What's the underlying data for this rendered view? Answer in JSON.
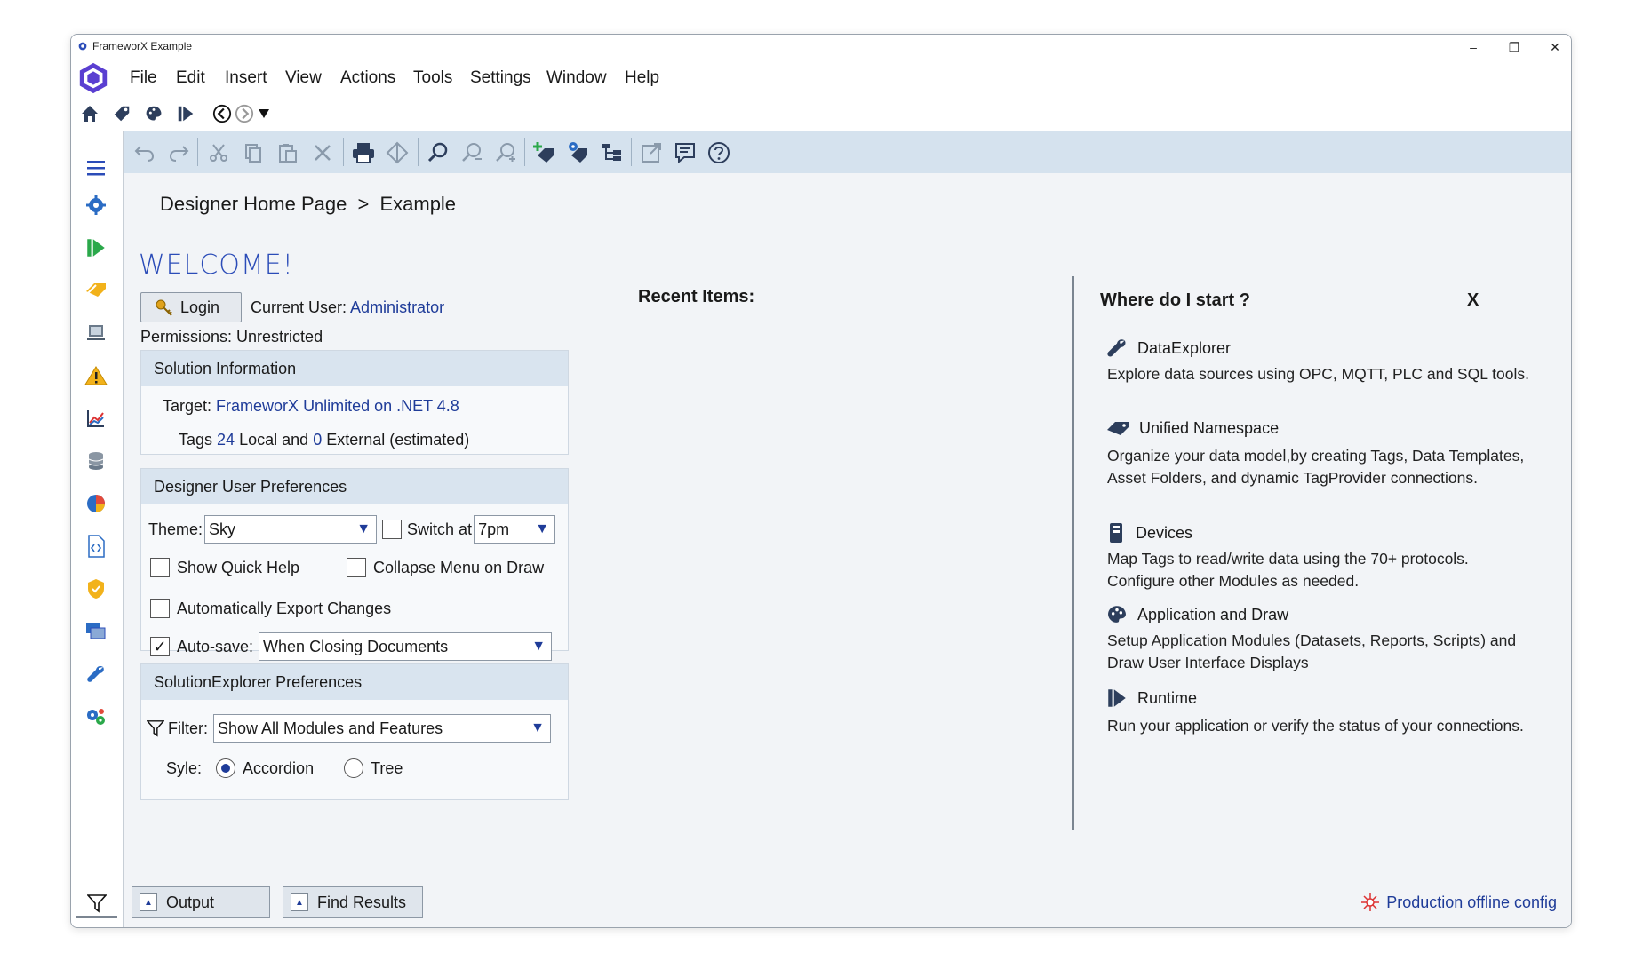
{
  "window": {
    "title": "FrameworX Example"
  },
  "window_controls": {
    "minimize": "–",
    "maximize": "❐",
    "close": "✕"
  },
  "menu": [
    "File",
    "Edit",
    "Insert",
    "View",
    "Actions",
    "Tools",
    "Settings",
    "Window",
    "Help"
  ],
  "breadcrumb": {
    "home": "Designer Home Page",
    "sep": ">",
    "current": "Example"
  },
  "welcome": "WELCOME!",
  "login": {
    "button": "Login",
    "current_user_label": "Current User:",
    "current_user": "Administrator",
    "permissions_label": "Permissions:",
    "permissions": "Unrestricted"
  },
  "solution_info": {
    "header": "Solution Information",
    "target_label": "Target:",
    "target": "FrameworX Unlimited on .NET 4.8",
    "tags_label": "Tags",
    "tags_local": "24",
    "local_text": "Local and",
    "tags_external": "0",
    "external_text": "External (estimated)"
  },
  "designer_prefs": {
    "header": "Designer User Preferences",
    "theme_label": "Theme:",
    "theme_value": "Sky",
    "switch_label": "Switch at",
    "switch_value": "7pm",
    "switch_checked": false,
    "show_quick_help": "Show Quick Help",
    "show_quick_help_checked": false,
    "collapse_menu": "Collapse Menu on Draw",
    "collapse_menu_checked": false,
    "auto_export": "Automatically Export Changes",
    "auto_export_checked": false,
    "auto_save_label": "Auto-save:",
    "auto_save_checked": true,
    "auto_save_value": "When Closing Documents"
  },
  "solution_explorer_prefs": {
    "header": "SolutionExplorer Preferences",
    "filter_label": "Filter:",
    "filter_value": "Show All Modules and Features",
    "style_label": "Syle:",
    "style_options": [
      "Accordion",
      "Tree"
    ],
    "style_selected": "Accordion"
  },
  "recent": {
    "title": "Recent Items:"
  },
  "where_start": {
    "title": "Where do I start ?",
    "close": "X",
    "items": [
      {
        "title": "DataExplorer",
        "icon": "wrench-icon",
        "desc": "Explore data sources using OPC, MQTT, PLC and SQL tools."
      },
      {
        "title": "Unified Namespace",
        "icon": "tag-icon",
        "desc": "Organize your data model,by creating Tags, Data Templates, Asset Folders, and dynamic TagProvider connections."
      },
      {
        "title": "Devices",
        "icon": "device-icon",
        "desc": "Map Tags to read/write data using the 70+ protocols. Configure other Modules as needed."
      },
      {
        "title": "Application and Draw",
        "icon": "palette-icon",
        "desc": "Setup Application Modules (Datasets, Reports, Scripts) and Draw User Interface Displays"
      },
      {
        "title": "Runtime",
        "icon": "runtime-icon",
        "desc": "Run your application or verify the status of your connections."
      }
    ]
  },
  "bottom": {
    "output": "Output",
    "find_results": "Find Results",
    "status": "Production offline config"
  },
  "colors": {
    "accent": "#1f3c99",
    "toolbar_bg": "#d5e2ee",
    "panel_head": "#d9e4ef",
    "welcome": "#2b4cb8"
  }
}
